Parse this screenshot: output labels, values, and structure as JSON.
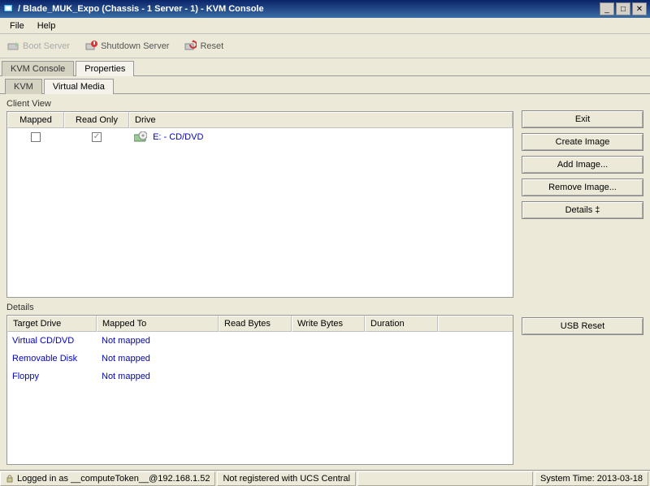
{
  "window": {
    "title": "/ Blade_MUK_Expo (Chassis - 1 Server - 1) - KVM Console"
  },
  "menu": {
    "file": "File",
    "help": "Help"
  },
  "toolbar": {
    "boot_server": "Boot Server",
    "shutdown_server": "Shutdown Server",
    "reset": "Reset"
  },
  "tabs_top": {
    "kvm_console": "KVM Console",
    "properties": "Properties"
  },
  "tabs_sub": {
    "kvm": "KVM",
    "virtual_media": "Virtual Media"
  },
  "client_view": {
    "label": "Client View",
    "headers": {
      "mapped": "Mapped",
      "read_only": "Read Only",
      "drive": "Drive"
    },
    "rows": [
      {
        "mapped": false,
        "read_only": true,
        "drive": "E: - CD/DVD"
      }
    ]
  },
  "buttons": {
    "exit": "Exit",
    "create_image": "Create Image",
    "add_image": "Add Image...",
    "remove_image": "Remove Image...",
    "details": "Details  ‡",
    "usb_reset": "USB Reset"
  },
  "details": {
    "label": "Details",
    "headers": {
      "target_drive": "Target Drive",
      "mapped_to": "Mapped To",
      "read_bytes": "Read Bytes",
      "write_bytes": "Write Bytes",
      "duration": "Duration"
    },
    "rows": [
      {
        "target_drive": "Virtual CD/DVD",
        "mapped_to": "Not mapped",
        "read_bytes": "",
        "write_bytes": "",
        "duration": ""
      },
      {
        "target_drive": "Removable Disk",
        "mapped_to": "Not mapped",
        "read_bytes": "",
        "write_bytes": "",
        "duration": ""
      },
      {
        "target_drive": "Floppy",
        "mapped_to": "Not mapped",
        "read_bytes": "",
        "write_bytes": "",
        "duration": ""
      }
    ]
  },
  "status": {
    "login": "Logged in as __computeToken__@192.168.1.52",
    "ucs": "Not registered with UCS Central",
    "time": "System Time: 2013-03-18"
  }
}
